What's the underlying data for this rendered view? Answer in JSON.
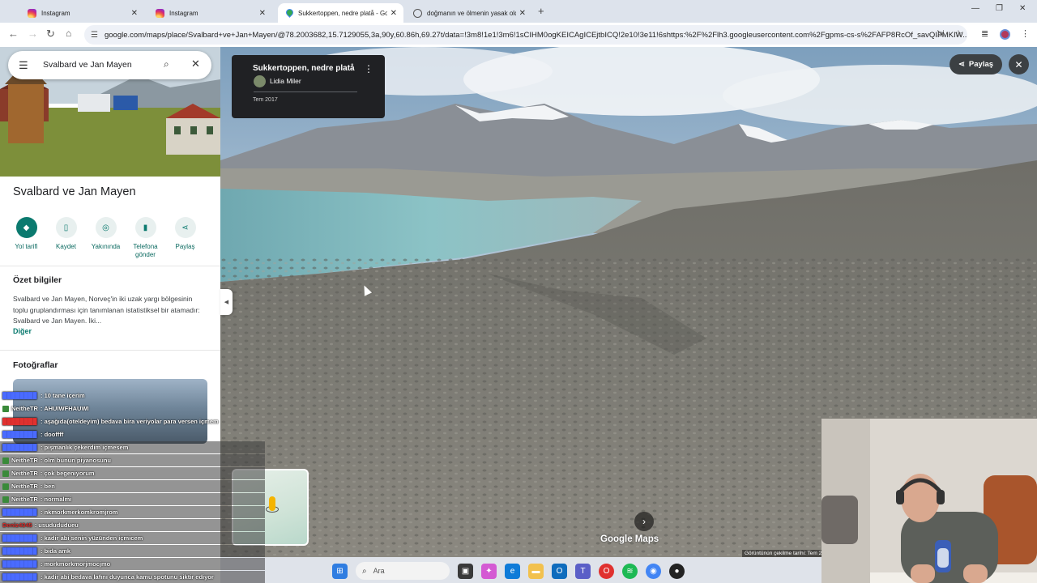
{
  "browser": {
    "tabs": [
      {
        "title": "Instagram",
        "icon": "instagram-icon",
        "active": false
      },
      {
        "title": "Instagram",
        "icon": "instagram-icon",
        "active": false
      },
      {
        "title": "Sukkertoppen, nedre platå - Go",
        "icon": "google-maps-icon",
        "active": true
      },
      {
        "title": "doğmanın ve ölmenin yasak old",
        "icon": "globe-icon",
        "active": false
      }
    ],
    "url": "google.com/maps/place/Svalbard+ve+Jan+Mayen/@78.2003682,15.7129055,3a,90y,60.86h,69.27t/data=!3m8!1e1!3m6!1sCIHM0ogKEICAgICEjtbICQ!2e10!3e11!6shttps:%2F%2Flh3.googleusercontent.com%2Fgpms-cs-s%2FAFP8RcOf_savQIFMKIW..."
  },
  "search": {
    "query": "Svalbard ve Jan Mayen"
  },
  "place": {
    "title": "Svalbard ve Jan Mayen",
    "actions": [
      {
        "label": "Yol tarifi",
        "icon": "directions-icon"
      },
      {
        "label": "Kaydet",
        "icon": "bookmark-icon"
      },
      {
        "label": "Yakınında",
        "icon": "nearby-icon"
      },
      {
        "label": "Telefona gönder",
        "icon": "send-to-phone-icon"
      },
      {
        "label": "Paylaş",
        "icon": "share-icon"
      }
    ],
    "summary_heading": "Özet bilgiler",
    "summary_text": "Svalbard ve Jan Mayen, Norveç'in iki uzak yargı bölgesinin toplu gruplandırması için tanımlanan istatistiksel bir atamadır: Svalbard ve Jan Mayen. İki...",
    "more_label": "Diğer",
    "photos_heading": "Fotoğraflar"
  },
  "streetview": {
    "title": "Sukkertoppen, nedre platå",
    "author": "Lidia Miler",
    "date": "Tem 2017",
    "share_label": "Paylaş",
    "watermark": "Google Maps",
    "capture_date": "Görüntünün çekilme tarihi: Tem 2"
  },
  "chat": [
    {
      "user": "",
      "text": ": 10 tane içerim",
      "color": "#4a6bff"
    },
    {
      "user": "NeitheTR",
      "text": ": AHUIWFHAUWI",
      "color": "#ffffff",
      "badge": true
    },
    {
      "user": "",
      "text": ": aşağıda(oteldeyim) bedava bira veriyolar para versen içmem",
      "color": "#e0312f"
    },
    {
      "user": "",
      "text": ": dooffff",
      "color": "#4a6bff"
    },
    {
      "user": "",
      "text": ": pişmanlık çekerdim içmesem",
      "color": "#4a6bff"
    },
    {
      "user": "NeitheTR",
      "text": ": olm bunun piyanosunu",
      "color": "#ffffff",
      "badge": true
    },
    {
      "user": "NeitheTR",
      "text": ": çok begeniyorum",
      "color": "#ffffff",
      "badge": true
    },
    {
      "user": "NeitheTR",
      "text": ": ben",
      "color": "#ffffff",
      "badge": true
    },
    {
      "user": "NeitheTR",
      "text": ": normalmi",
      "color": "#ffffff",
      "badge": true
    },
    {
      "user": "",
      "text": ": nkmorkmerkomkromjrom",
      "color": "#4a6bff"
    },
    {
      "user": "Deniz4345",
      "text": ": usudududueu",
      "color": "#e0312f"
    },
    {
      "user": "",
      "text": ": kadir abi senin yüzünden içmicem",
      "color": "#4a6bff"
    },
    {
      "user": "",
      "text": ": bida amk",
      "color": "#4a6bff"
    },
    {
      "user": "",
      "text": ": morkmorkmorjmocjmo",
      "color": "#4a6bff"
    },
    {
      "user": "",
      "text": ": kadir abi bedava lafını duyunca kamu spotunu siktir ediyor",
      "color": "#4a6bff"
    }
  ],
  "taskbar": {
    "search_placeholder": "Ara"
  }
}
